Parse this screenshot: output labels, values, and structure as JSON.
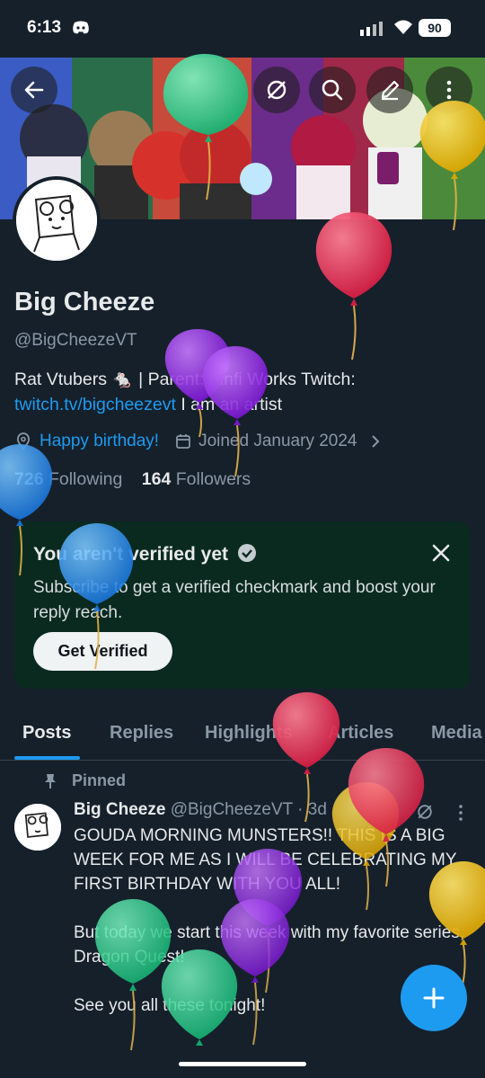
{
  "status": {
    "time": "6:13",
    "battery": "90"
  },
  "profile": {
    "name": "Big Cheeze",
    "handle": "@BigCheezeVT",
    "bio_line1": "Rat Vtubers 🐁 | Parent: Finfi Works  Twitch:",
    "bio_link": "twitch.tv/bigcheezevt",
    "bio_tail": " I am an artist",
    "birthday": "Happy birthday!",
    "joined": "Joined January 2024",
    "following_count": "726",
    "following_label": "Following",
    "followers_count": "164",
    "followers_label": "Followers"
  },
  "verify_card": {
    "title": "You aren't verified yet",
    "description": "Subscribe to get a verified checkmark and boost your reply reach.",
    "button": "Get Verified"
  },
  "tabs": [
    "Posts",
    "Replies",
    "Highlights",
    "Articles",
    "Media"
  ],
  "pinned_label": "Pinned",
  "tweet": {
    "name": "Big Cheeze",
    "handle": "@BigCheezeVT",
    "time": "· 3d",
    "body": "GOUDA MORNING MUNSTERS!! THIS IS A BIG WEEK FOR ME AS I WILL BE CELEBRATING MY FIRST BIRTHDAY WITH YOU ALL!\n\nBut today we start this week with my favorite series, Dragon Quest!\n\nSee you all these tonight!"
  },
  "colors": {
    "accent": "#1d9bf0",
    "background": "#15202b"
  }
}
